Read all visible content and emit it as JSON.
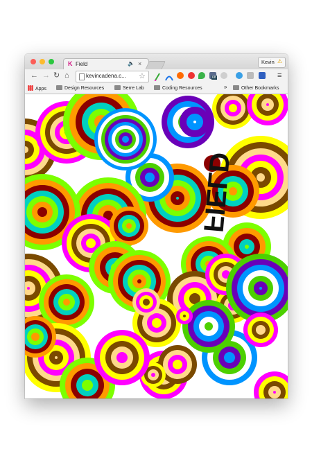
{
  "window": {
    "tab": {
      "favicon": "K",
      "title": "Field",
      "audio_icon": "speaker-icon",
      "close_icon": "×"
    },
    "profile": {
      "name": "Kevin",
      "icon": "warning-icon"
    },
    "toolbar": {
      "back": "←",
      "forward": "→",
      "reload": "↻",
      "home": "⌂",
      "url": "kevincadena.c...",
      "star": "☆",
      "menu": "≡"
    },
    "extensions": [
      "pen-icon",
      "arc-icon",
      "compass-icon",
      "pin-icon",
      "badge-icon",
      "info-icon",
      "check-icon",
      "cast-icon",
      "ie-icon"
    ],
    "extension_badge": "68",
    "bookmarks": {
      "apps": "Apps",
      "items": [
        "Design Resources",
        "Serre Lab",
        "Coding Resources"
      ],
      "overflow": "»",
      "other": "Other Bookmarks"
    }
  },
  "page": {
    "logo_text": "FIELD",
    "colors": {
      "magenta": "#ff00ff",
      "lime": "#7cff00",
      "green": "#4cd000",
      "yellow": "#ffff00",
      "orange": "#ff9a00",
      "purple": "#6a00b8",
      "brown": "#7a4a00",
      "maroon": "#8b0000",
      "blue": "#0094ff",
      "peach": "#ffd98a",
      "teal": "#00d0c0"
    }
  }
}
